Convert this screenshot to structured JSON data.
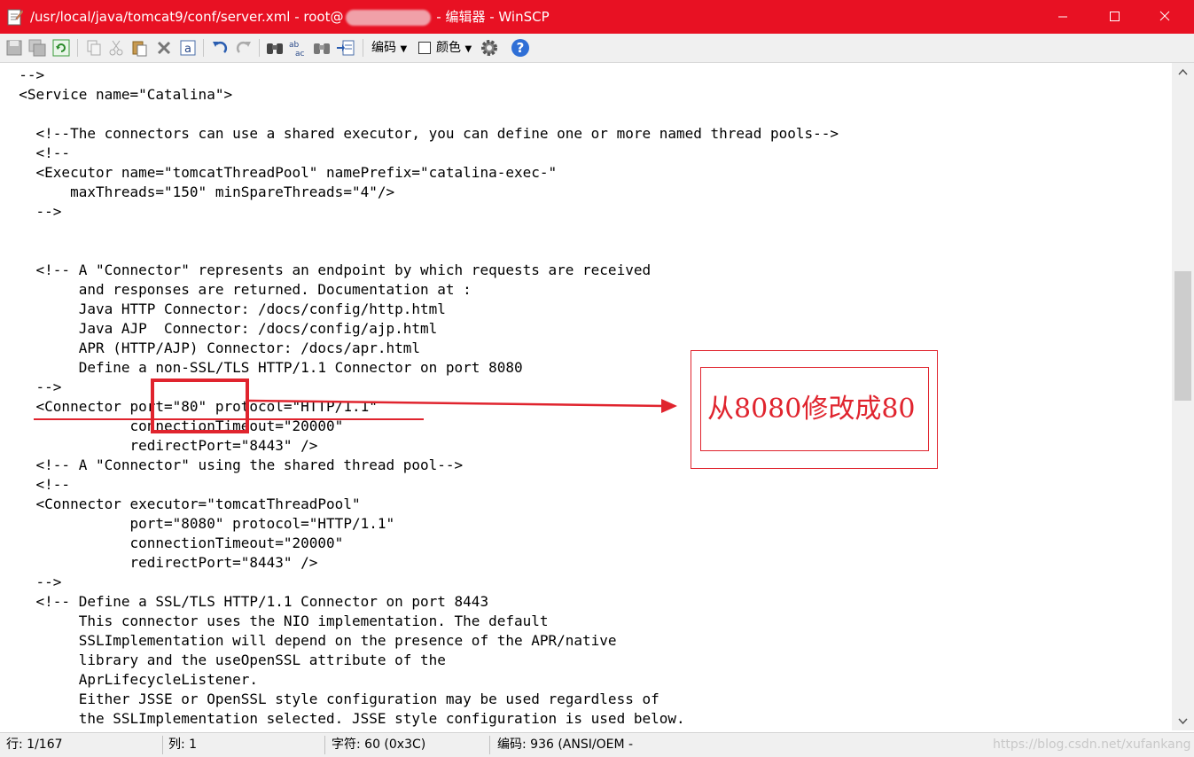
{
  "window": {
    "title_prefix": "/usr/local/java/tomcat9/conf/server.xml - root@",
    "title_suffix": " - 编辑器 - WinSCP"
  },
  "toolbar": {
    "encoding_label": "编码",
    "color_label": "颜色"
  },
  "code_lines": [
    "  -->",
    "  <Service name=\"Catalina\">",
    "",
    "    <!--The connectors can use a shared executor, you can define one or more named thread pools-->",
    "    <!--",
    "    <Executor name=\"tomcatThreadPool\" namePrefix=\"catalina-exec-\"",
    "        maxThreads=\"150\" minSpareThreads=\"4\"/>",
    "    -->",
    "",
    "",
    "    <!-- A \"Connector\" represents an endpoint by which requests are received",
    "         and responses are returned. Documentation at :",
    "         Java HTTP Connector: /docs/config/http.html",
    "         Java AJP  Connector: /docs/config/ajp.html",
    "         APR (HTTP/AJP) Connector: /docs/apr.html",
    "         Define a non-SSL/TLS HTTP/1.1 Connector on port 8080",
    "    -->",
    "    <Connector port=\"80\" protocol=\"HTTP/1.1\"",
    "               connectionTimeout=\"20000\"",
    "               redirectPort=\"8443\" />",
    "    <!-- A \"Connector\" using the shared thread pool-->",
    "    <!--",
    "    <Connector executor=\"tomcatThreadPool\"",
    "               port=\"8080\" protocol=\"HTTP/1.1\"",
    "               connectionTimeout=\"20000\"",
    "               redirectPort=\"8443\" />",
    "    -->",
    "    <!-- Define a SSL/TLS HTTP/1.1 Connector on port 8443",
    "         This connector uses the NIO implementation. The default",
    "         SSLImplementation will depend on the presence of the APR/native",
    "         library and the useOpenSSL attribute of the",
    "         AprLifecycleListener.",
    "         Either JSSE or OpenSSL style configuration may be used regardless of",
    "         the SSLImplementation selected. JSSE style configuration is used below."
  ],
  "annotation": {
    "text": "从8080修改成80"
  },
  "status": {
    "line": "行: 1/167",
    "column": "列: 1",
    "char": "字符: 60 (0x3C)",
    "encoding": "编码: 936  (ANSI/OEM -"
  },
  "watermark": "https://blog.csdn.net/xufankang"
}
